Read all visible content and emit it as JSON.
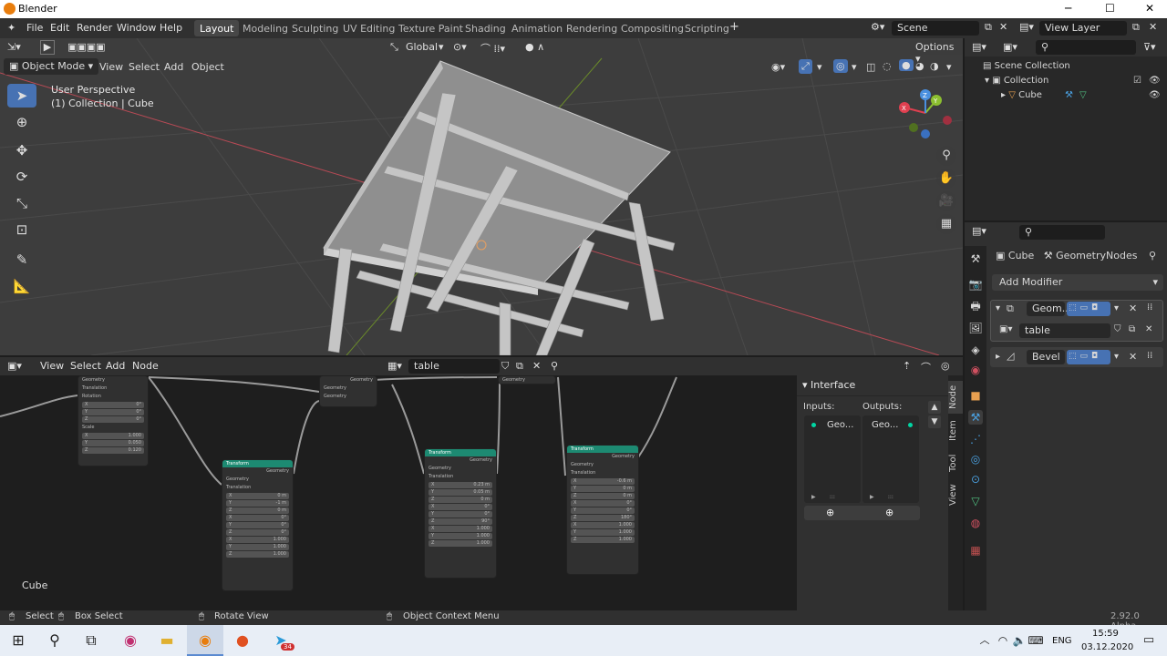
{
  "window": {
    "title": "Blender"
  },
  "menu": {
    "file": "File",
    "edit": "Edit",
    "render": "Render",
    "window": "Window",
    "help": "Help"
  },
  "workspaces": [
    "Layout",
    "Modeling",
    "Sculpting",
    "UV Editing",
    "Texture Paint",
    "Shading",
    "Animation",
    "Rendering",
    "Compositing",
    "Scripting"
  ],
  "scene": {
    "name": "Scene",
    "view_layer": "View Layer"
  },
  "viewport": {
    "mode": "Object Mode",
    "menus": [
      "View",
      "Select",
      "Add",
      "Object"
    ],
    "transform_orientation": "Global",
    "options": "Options",
    "info_line1": "User Perspective",
    "info_line2": "(1) Collection | Cube"
  },
  "outliner": {
    "scene_collection": "Scene Collection",
    "collection": "Collection",
    "object": "Cube"
  },
  "properties": {
    "object": "Cube",
    "modifier_context": "GeometryNodes",
    "add_modifier": "Add Modifier",
    "modifiers": [
      {
        "name": "Geom..."
      },
      {
        "name": "Bevel"
      }
    ],
    "node_group": "table"
  },
  "node_editor": {
    "menus": [
      "View",
      "Select",
      "Add",
      "Node"
    ],
    "node_tree": "table",
    "object_label": "Cube",
    "sidebar": {
      "title": "Interface",
      "inputs": "Inputs:",
      "outputs": "Outputs:",
      "input_item": "Geo...",
      "output_item": "Geo..."
    },
    "tabs": [
      "Node",
      "Item",
      "Tool",
      "View"
    ],
    "nodes": [
      {
        "title": "",
        "rows": [
          "Geometry",
          "Translation",
          "Rotation"
        ],
        "values": [
          [
            "X",
            "0°"
          ],
          [
            "Y",
            "0°"
          ],
          [
            "Z",
            "0°"
          ]
        ],
        "scale_label": "Scale",
        "scale": [
          [
            "X",
            "1.000"
          ],
          [
            "Y",
            "0.050"
          ],
          [
            "Z",
            "0.120"
          ]
        ]
      },
      {
        "title": "Transform",
        "rows": [
          "Geometry",
          "Translation"
        ],
        "values": [
          [
            "X",
            "0 m"
          ],
          [
            "Y",
            "-1 m"
          ],
          [
            "Z",
            "0 m"
          ]
        ],
        "rot": [
          [
            "X",
            "0°"
          ],
          [
            "Y",
            "0°"
          ],
          [
            "Z",
            "0°"
          ]
        ],
        "scale": [
          [
            "X",
            "1.000"
          ],
          [
            "Y",
            "1.000"
          ],
          [
            "Z",
            "1.000"
          ]
        ]
      },
      {
        "title": "Transform",
        "rows": [
          "Geometry",
          "Translation"
        ],
        "values": [
          [
            "X",
            "0.23 m"
          ],
          [
            "Y",
            "0.05 m"
          ],
          [
            "Z",
            "0 m"
          ]
        ],
        "rot": [
          [
            "X",
            "0°"
          ],
          [
            "Y",
            "0°"
          ],
          [
            "Z",
            "90°"
          ]
        ],
        "scale": [
          [
            "X",
            "1.000"
          ],
          [
            "Y",
            "1.000"
          ],
          [
            "Z",
            "1.000"
          ]
        ]
      },
      {
        "title": "Transform",
        "rows": [
          "Geometry",
          "Translation"
        ],
        "values": [
          [
            "X",
            "-0.6 m"
          ],
          [
            "Y",
            "0 m"
          ],
          [
            "Z",
            "0 m"
          ]
        ],
        "rot": [
          [
            "X",
            "0°"
          ],
          [
            "Y",
            "0°"
          ],
          [
            "Z",
            "180°"
          ]
        ],
        "scale": [
          [
            "X",
            "1.000"
          ],
          [
            "Y",
            "1.000"
          ],
          [
            "Z",
            "1.000"
          ]
        ]
      }
    ],
    "join_label": "Geometry",
    "output_label": "Geometry"
  },
  "statusbar": {
    "select": "Select",
    "box_select": "Box Select",
    "rotate_view": "Rotate View",
    "context_menu": "Object Context Menu",
    "version": "2.92.0 Alpha"
  },
  "taskbar": {
    "lang": "ENG",
    "time": "15:59",
    "date": "03.12.2020",
    "badge": "34"
  }
}
